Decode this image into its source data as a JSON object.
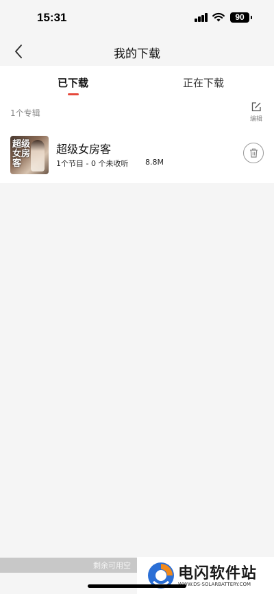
{
  "status_bar": {
    "time": "15:31",
    "battery": "90"
  },
  "header": {
    "title": "我的下载",
    "back_icon": "chevron-left-icon"
  },
  "tabs": [
    {
      "label": "已下载",
      "active": true
    },
    {
      "label": "正在下载",
      "active": false
    }
  ],
  "toolbar": {
    "album_count": "1个专辑",
    "edit_label": "编辑",
    "edit_icon": "edit-icon"
  },
  "albums": [
    {
      "title": "超级女房客",
      "meta": "1个节目 - 0 个未收听",
      "size": "8.8M",
      "cover_text": "超级女房客",
      "delete_icon": "trash-icon"
    }
  ],
  "footer": {
    "storage_text": "剩余可用空"
  },
  "watermark": {
    "title": "电闪软件站",
    "url": "WWW.DS-SOLARBATTERY.COM"
  },
  "colors": {
    "accent": "#e5483b",
    "background": "#f5f5f5",
    "card": "#ffffff"
  }
}
